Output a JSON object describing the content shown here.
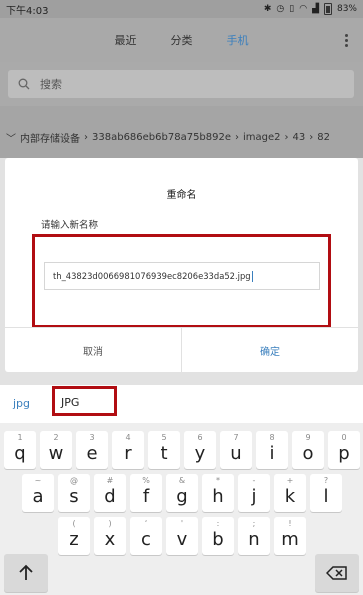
{
  "status_bar": {
    "time": "下午4:03",
    "battery": "83%"
  },
  "tabs": [
    "最近",
    "分类",
    "手机"
  ],
  "search": {
    "placeholder": "搜索"
  },
  "breadcrumb": {
    "path": [
      "内部存储设备",
      "338ab686eb6b78a75b892e",
      "image2",
      "43",
      "82"
    ]
  },
  "dialog": {
    "title": "重命名",
    "prompt": "请输入新名称",
    "input_value": "th_43823d0066981076939ec8206e33da52.jpg",
    "cancel": "取消",
    "confirm": "确定"
  },
  "suggestions": [
    "jpg",
    "JPG"
  ],
  "keyboard": {
    "row1": [
      {
        "k": "q",
        "s": "1"
      },
      {
        "k": "w",
        "s": "2"
      },
      {
        "k": "e",
        "s": "3"
      },
      {
        "k": "r",
        "s": "4"
      },
      {
        "k": "t",
        "s": "5"
      },
      {
        "k": "y",
        "s": "6"
      },
      {
        "k": "u",
        "s": "7"
      },
      {
        "k": "i",
        "s": "8"
      },
      {
        "k": "o",
        "s": "9"
      },
      {
        "k": "p",
        "s": "0"
      }
    ],
    "row2": [
      {
        "k": "a",
        "s": "~"
      },
      {
        "k": "s",
        "s": "@"
      },
      {
        "k": "d",
        "s": "#"
      },
      {
        "k": "f",
        "s": "%"
      },
      {
        "k": "g",
        "s": "&"
      },
      {
        "k": "h",
        "s": "*"
      },
      {
        "k": "j",
        "s": "-"
      },
      {
        "k": "k",
        "s": "+"
      },
      {
        "k": "l",
        "s": "?"
      }
    ],
    "row3": [
      {
        "k": "z",
        "s": "("
      },
      {
        "k": "x",
        "s": ")"
      },
      {
        "k": "c",
        "s": "‘"
      },
      {
        "k": "v",
        "s": "'"
      },
      {
        "k": "b",
        "s": ":"
      },
      {
        "k": "n",
        "s": ";"
      },
      {
        "k": "m",
        "s": "!"
      }
    ],
    "shift_icon": "shift-arrow-icon",
    "delete_icon": "backspace-icon"
  },
  "colors": {
    "accent": "#3a7fbd",
    "highlight_box": "#b10d12"
  }
}
